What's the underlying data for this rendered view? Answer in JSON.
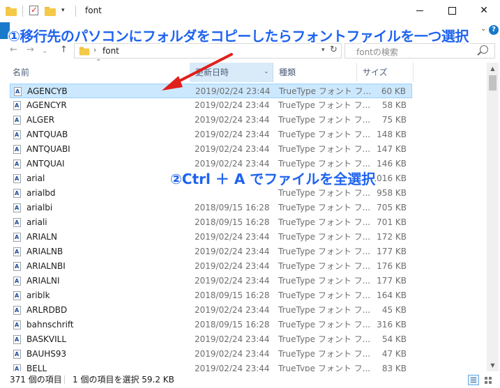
{
  "window": {
    "title": "font",
    "minimize_glyph": "",
    "close_glyph": "✕"
  },
  "ribbon": {
    "expand_glyph": "⌄",
    "help_glyph": "?"
  },
  "nav": {
    "back_glyph": "←",
    "forward_glyph": "→",
    "recent_glyph": "⌄",
    "up_glyph": "↑",
    "address_sep": "›",
    "address": "font",
    "refresh_glyph": "↻",
    "search_placeholder": "fontの検索"
  },
  "columns": {
    "name": "名前",
    "date": "更新日時",
    "type": "種類",
    "size": "サイズ",
    "sort_glyph": "⌃",
    "dropdown_glyph": "⌄"
  },
  "files": [
    {
      "name": "AGENCYB",
      "date": "2019/02/24 23:44",
      "type": "TrueType フォント フ...",
      "size": "60 KB",
      "selected": true
    },
    {
      "name": "AGENCYR",
      "date": "2019/02/24 23:44",
      "type": "TrueType フォント フ...",
      "size": "58 KB"
    },
    {
      "name": "ALGER",
      "date": "2019/02/24 23:44",
      "type": "TrueType フォント フ...",
      "size": "75 KB"
    },
    {
      "name": "ANTQUAB",
      "date": "2019/02/24 23:44",
      "type": "TrueType フォント フ...",
      "size": "148 KB"
    },
    {
      "name": "ANTQUABI",
      "date": "2019/02/24 23:44",
      "type": "TrueType フォント フ...",
      "size": "147 KB"
    },
    {
      "name": "ANTQUAI",
      "date": "2019/02/24 23:44",
      "type": "TrueType フォント フ...",
      "size": "146 KB"
    },
    {
      "name": "arial",
      "date": "",
      "type": "",
      "size": "1,016 KB"
    },
    {
      "name": "arialbd",
      "date": "",
      "type": "TrueType フォント フ...",
      "size": "958 KB"
    },
    {
      "name": "arialbi",
      "date": "2018/09/15 16:28",
      "type": "TrueType フォント フ...",
      "size": "705 KB"
    },
    {
      "name": "ariali",
      "date": "2018/09/15 16:28",
      "type": "TrueType フォント フ...",
      "size": "701 KB"
    },
    {
      "name": "ARIALN",
      "date": "2019/02/24 23:44",
      "type": "TrueType フォント フ...",
      "size": "172 KB"
    },
    {
      "name": "ARIALNB",
      "date": "2019/02/24 23:44",
      "type": "TrueType フォント フ...",
      "size": "177 KB"
    },
    {
      "name": "ARIALNBI",
      "date": "2019/02/24 23:44",
      "type": "TrueType フォント フ...",
      "size": "176 KB"
    },
    {
      "name": "ARIALNI",
      "date": "2019/02/24 23:44",
      "type": "TrueType フォント フ...",
      "size": "177 KB"
    },
    {
      "name": "ariblk",
      "date": "2018/09/15 16:28",
      "type": "TrueType フォント フ...",
      "size": "164 KB"
    },
    {
      "name": "ARLRDBD",
      "date": "2019/02/24 23:44",
      "type": "TrueType フォント フ...",
      "size": "45 KB"
    },
    {
      "name": "bahnschrift",
      "date": "2018/09/15 16:28",
      "type": "TrueType フォント フ...",
      "size": "316 KB"
    },
    {
      "name": "BASKVILL",
      "date": "2019/02/24 23:44",
      "type": "TrueType フォント フ...",
      "size": "54 KB"
    },
    {
      "name": "BAUHS93",
      "date": "2019/02/24 23:44",
      "type": "TrueType フォント フ...",
      "size": "47 KB"
    },
    {
      "name": "BELL",
      "date": "2019/02/24 23:44",
      "type": "TrueType フォント フ...",
      "size": "83 KB"
    }
  ],
  "status": {
    "item_count": "371 個の項目",
    "selection": "1 個の項目を選択 59.2 KB"
  },
  "scrollbar": {
    "up_glyph": "▲",
    "down_glyph": "▼"
  },
  "annotations": {
    "step1": "①移行先のパソコンにフォルダをコピーしたらフォントファイルを一つ選択",
    "step2": "②Ctrl ＋ A でファイルを全選択",
    "color": "#1e63f0",
    "arrow_color": "#e0201b"
  },
  "colors": {
    "selection_bg": "#cce8ff",
    "selection_border": "#99d1ff",
    "accent": "#1979ca"
  }
}
